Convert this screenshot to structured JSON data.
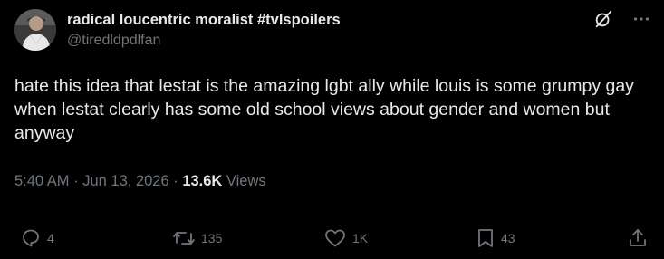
{
  "author": {
    "display_name": "radical loucentric moralist #tvlspoilers",
    "handle": "@tiredldpdlfan",
    "avatar_icon": "profile-photo"
  },
  "header_icons": [
    "grok-icon",
    "more-icon"
  ],
  "tweet": {
    "text": "hate this idea that lestat is the amazing lgbt ally while louis is some grumpy gay when lestat clearly has some old school views about gender and women but anyway"
  },
  "meta": {
    "time": "5:40 AM",
    "sep1": " · ",
    "date": "Jun 13, 2026",
    "sep2": " · ",
    "views_count": "13.6K",
    "views_label": " Views"
  },
  "actions": {
    "reply_count": "4",
    "repost_count": "135",
    "like_count": "1K",
    "bookmark_count": "43"
  },
  "colors": {
    "background": "#000000",
    "text_primary": "#e7e9ea",
    "text_secondary": "#71767b"
  }
}
